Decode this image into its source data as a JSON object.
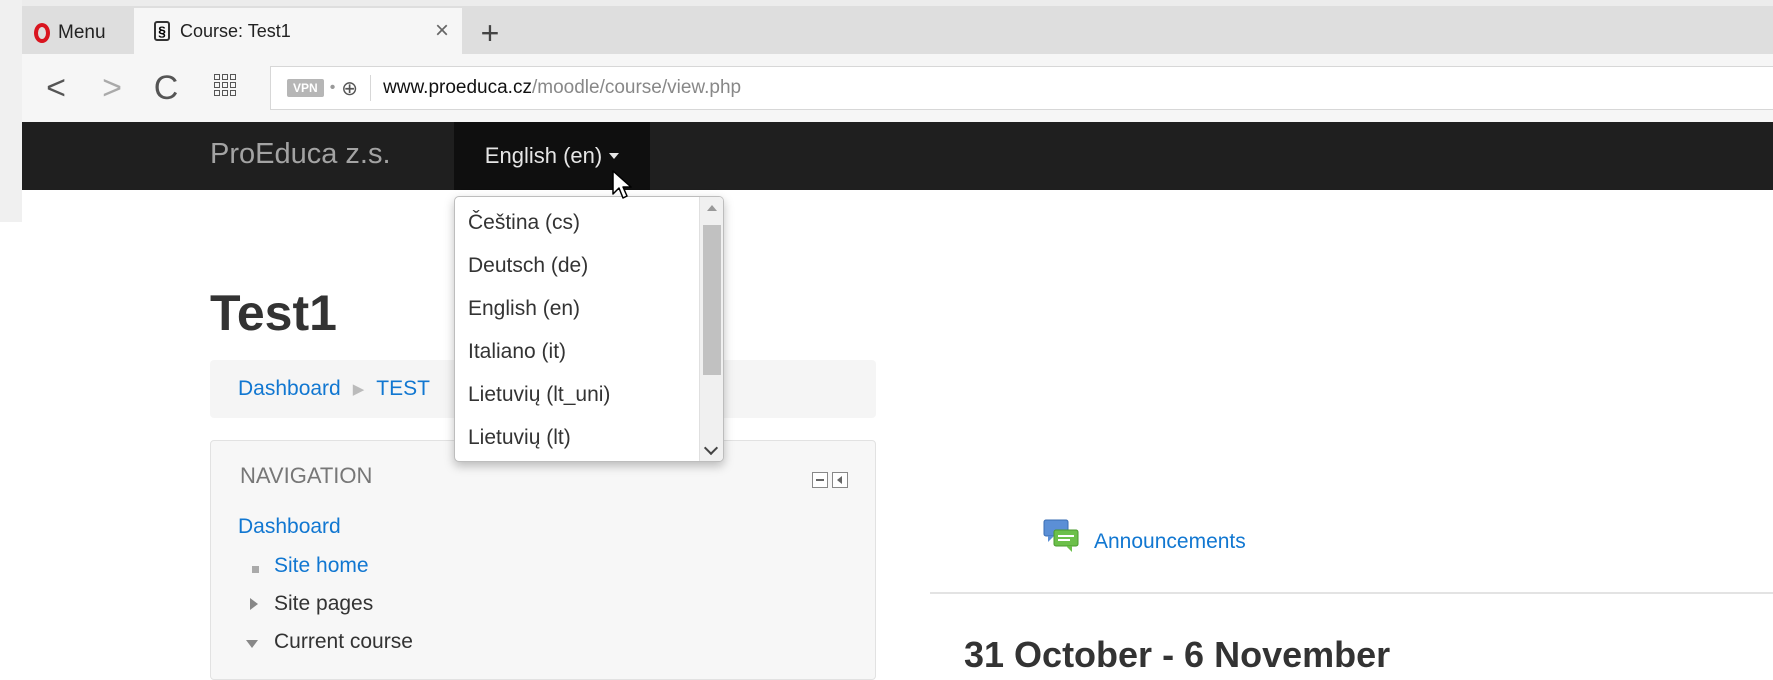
{
  "browser": {
    "menu_label": "Menu",
    "tab_title": "Course: Test1",
    "tab_close": "×",
    "new_tab": "+",
    "back": "<",
    "forward": ">",
    "reload": "C",
    "vpn_badge": "VPN",
    "url_host": "www.proeduca.cz",
    "url_path": "/moodle/course/view.php",
    "accent_color": "#d9151f"
  },
  "navbar": {
    "brand": "ProEduca z.s.",
    "language_button": "English (en)"
  },
  "language_menu": {
    "options": [
      "Čeština (cs)",
      "Deutsch (de)",
      "English (en)",
      "Italiano (it)",
      "Lietuvių (lt_uni)",
      "Lietuvių (lt)"
    ]
  },
  "page": {
    "title": "Test1",
    "breadcrumb": [
      "Dashboard",
      "TEST"
    ]
  },
  "navigation_block": {
    "header": "NAVIGATION",
    "items": [
      {
        "label": "Dashboard",
        "type": "link"
      },
      {
        "label": "Site home",
        "type": "link"
      },
      {
        "label": "Site pages",
        "type": "collapsed"
      },
      {
        "label": "Current course",
        "type": "expanded"
      }
    ]
  },
  "course": {
    "announcements": "Announcements",
    "week_heading": "31 October - 6 November"
  },
  "colors": {
    "navbar_bg": "#1f1f1f",
    "link": "#1177d1"
  }
}
